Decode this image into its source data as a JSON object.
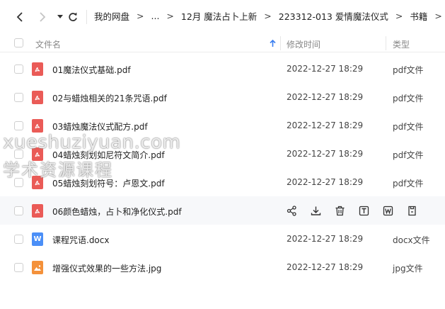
{
  "nav": {
    "back_icon": "chevron-left-icon",
    "forward_icon": "chevron-right-icon",
    "dropdown_icon": "caret-down-icon",
    "refresh_icon": "refresh-icon",
    "breadcrumbs": [
      {
        "label": "我的网盘"
      },
      {
        "label": "..."
      },
      {
        "label": "12月 魔法占卜上新"
      },
      {
        "label": "223312-013 爱情魔法仪式"
      },
      {
        "label": "书籍"
      }
    ],
    "separator": ">"
  },
  "table": {
    "headers": {
      "name": "文件名",
      "modified": "修改时间",
      "type": "类型"
    },
    "sort_icon": "arrow-up-icon",
    "rows": [
      {
        "name": "01魔法仪式基础.pdf",
        "modified": "2022-12-27 18:29",
        "type": "pdf文件",
        "icon": "pdf-file-icon",
        "hover": false
      },
      {
        "name": "02与蜡烛相关的21条咒语.pdf",
        "modified": "2022-12-27 18:29",
        "type": "pdf文件",
        "icon": "pdf-file-icon",
        "hover": false
      },
      {
        "name": "03蜡烛魔法仪式配方.pdf",
        "modified": "2022-12-27 18:29",
        "type": "pdf文件",
        "icon": "pdf-file-icon",
        "hover": false
      },
      {
        "name": "04蜡烛刻划如尼符文简介.pdf",
        "modified": "2022-12-27 18:29",
        "type": "pdf文件",
        "icon": "pdf-file-icon",
        "hover": false
      },
      {
        "name": "05蜡烛刻划符号：卢恩文.pdf",
        "modified": "2022-12-27 18:29",
        "type": "pdf文件",
        "icon": "pdf-file-icon",
        "hover": false
      },
      {
        "name": "06颜色蜡烛，占卜和净化仪式.pdf",
        "modified": "",
        "type": "",
        "icon": "pdf-file-icon",
        "hover": true
      },
      {
        "name": "课程咒语.docx",
        "modified": "2022-12-27 18:29",
        "type": "docx文件",
        "icon": "word-file-icon",
        "hover": false
      },
      {
        "name": "增强仪式效果的一些方法.jpg",
        "modified": "2022-12-27 18:29",
        "type": "jpg文件",
        "icon": "image-file-icon",
        "hover": false
      }
    ],
    "hover_actions": [
      "share-icon",
      "download-icon",
      "delete-icon",
      "rename-icon",
      "convert-icon",
      "more-icon"
    ]
  },
  "watermark": {
    "line1": "xueshuziyuan.com",
    "line2": "学术资源课程"
  }
}
